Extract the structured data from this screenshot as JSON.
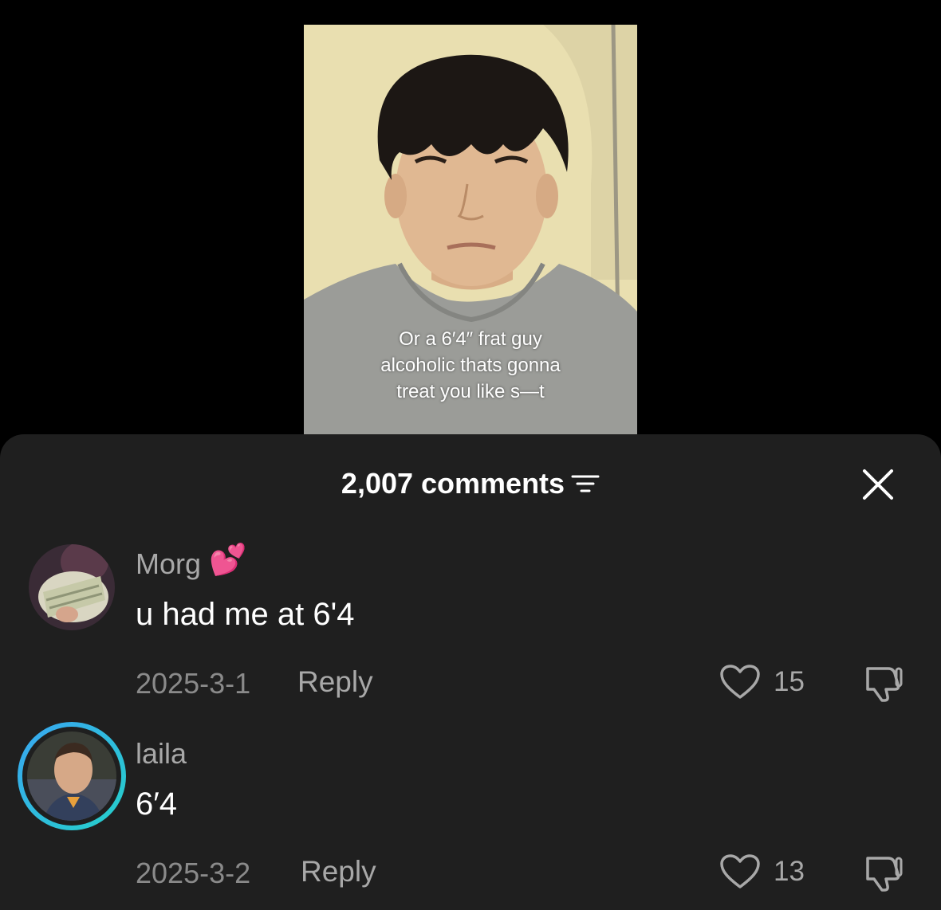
{
  "video": {
    "caption_lines": [
      "Or a 6′4″ frat guy",
      "alcoholic thats gonna",
      "treat you like s—t"
    ]
  },
  "comments_panel": {
    "title": "2,007 comments",
    "filter_icon": "filter-icon",
    "close_icon": "close-icon"
  },
  "comments": [
    {
      "username": "Morg",
      "username_emoji": "💕",
      "text": "u had me at 6'4",
      "date": "2025-3-1",
      "reply_label": "Reply",
      "likes": "15"
    },
    {
      "username": "laila",
      "text": "6′4",
      "date": "2025-3-2",
      "reply_label": "Reply",
      "likes": "13"
    }
  ],
  "colors": {
    "sheet_bg": "#1f1f1f",
    "story_ring": "#2fc6e8"
  }
}
